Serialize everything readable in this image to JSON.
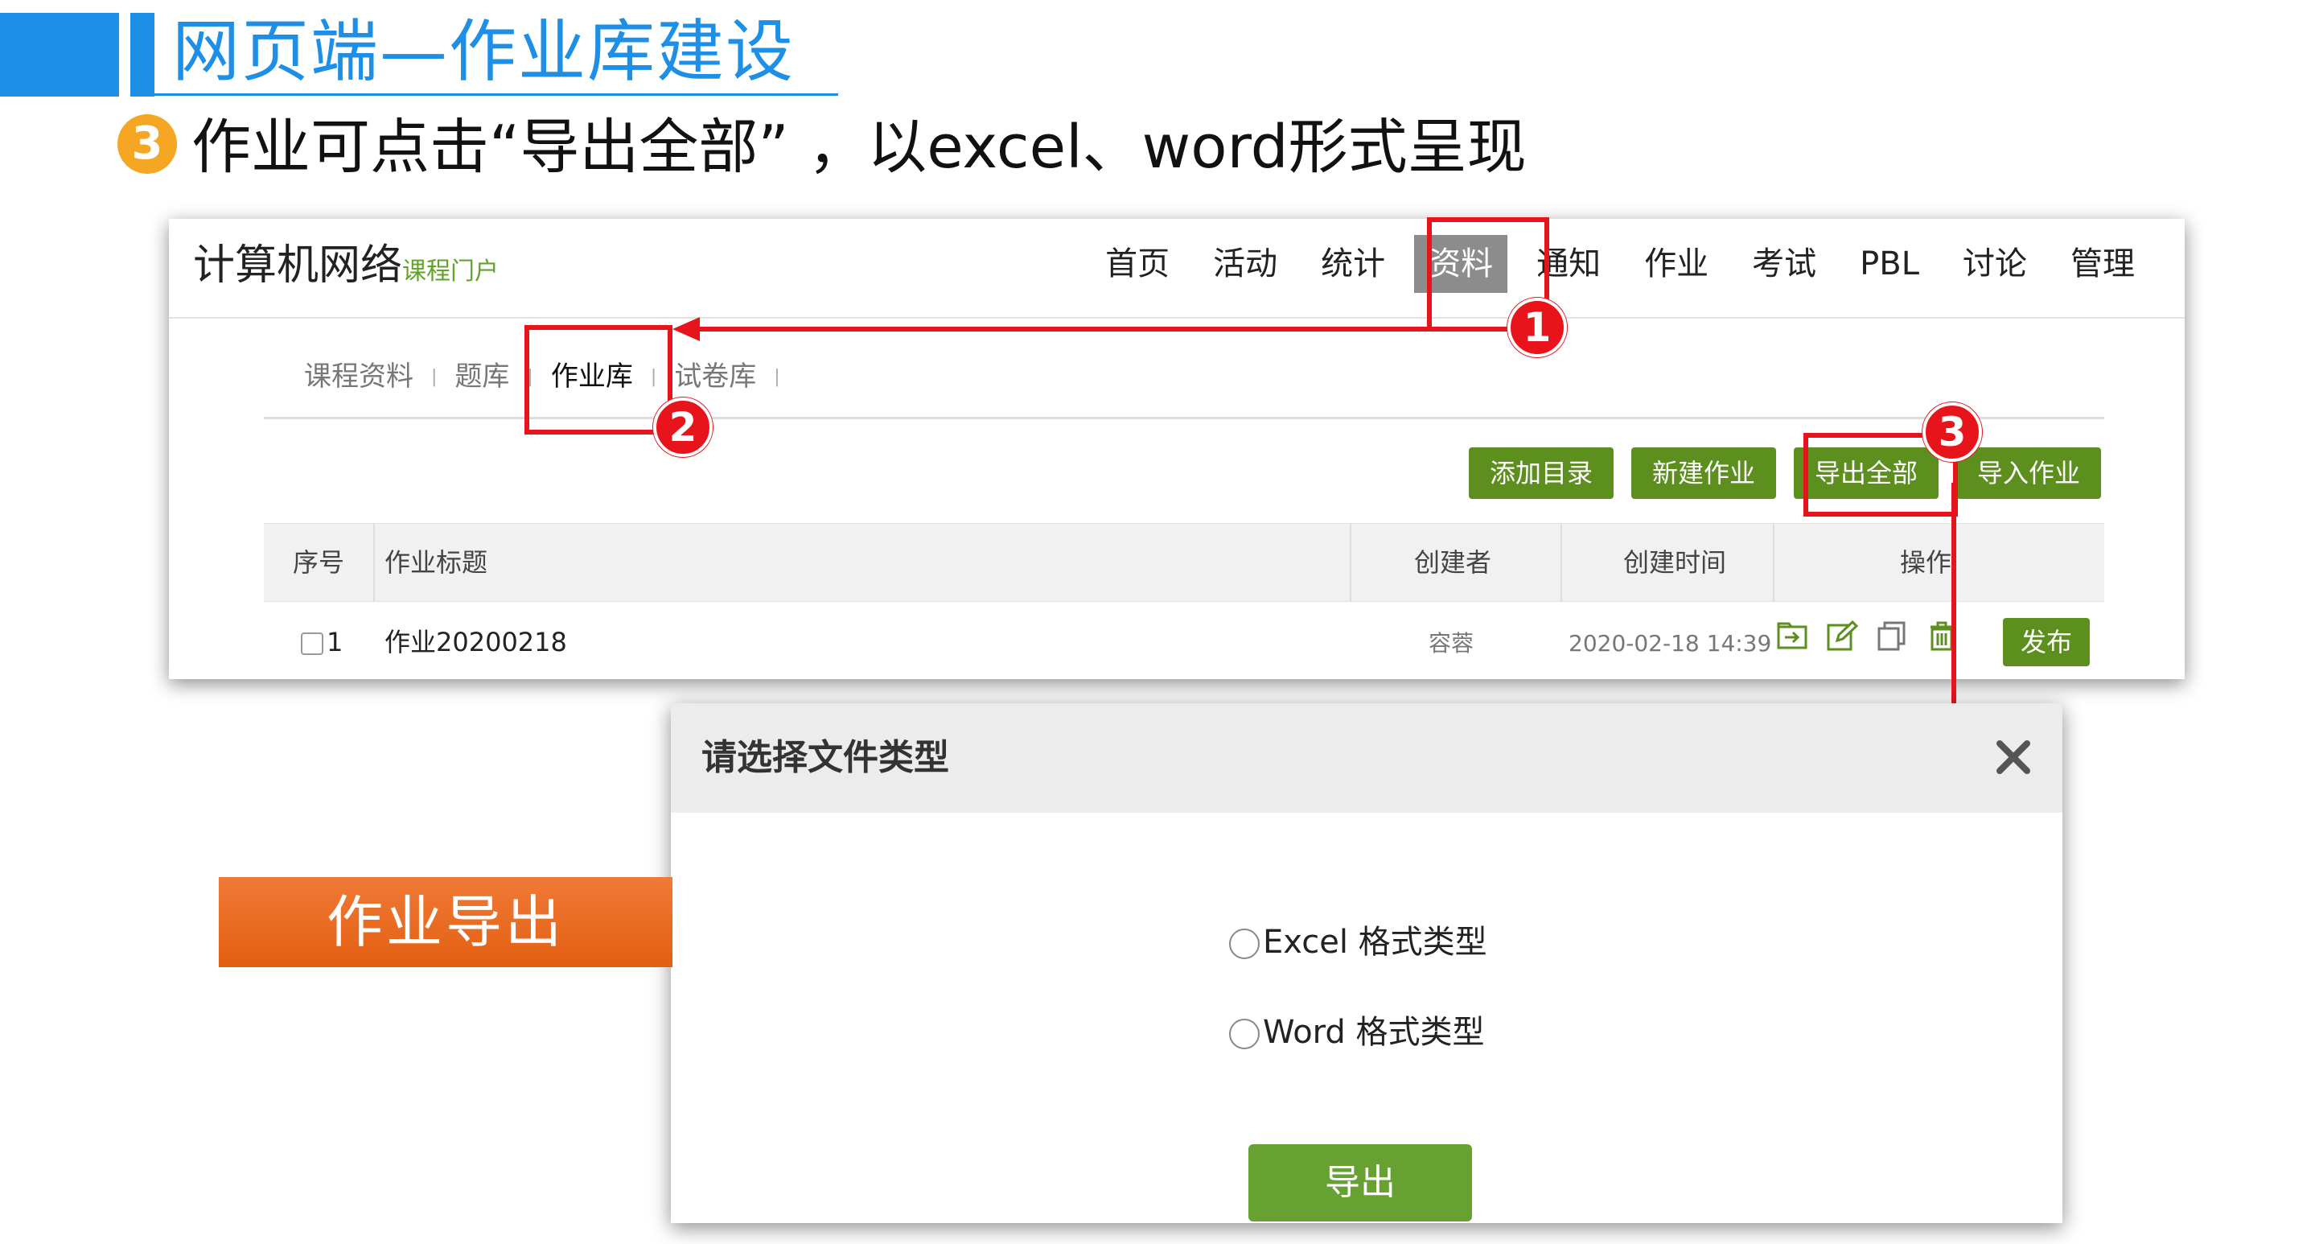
{
  "slide": {
    "title": "网页端—作业库建设",
    "step_number": "3",
    "step_text": "作业可点击“导出全部” ，以excel、word形式呈现"
  },
  "portal": {
    "course_name": "计算机网络",
    "course_sub": "课程门户",
    "nav": [
      "首页",
      "活动",
      "统计",
      "资料",
      "通知",
      "作业",
      "考试",
      "PBL",
      "讨论",
      "管理"
    ],
    "nav_active": "资料",
    "subtabs": [
      "课程资料",
      "题库",
      "作业库",
      "试卷库"
    ],
    "subtab_active": "作业库",
    "buttons": {
      "add_dir": "添加目录",
      "new_hw": "新建作业",
      "export_all": "导出全部",
      "import_hw": "导入作业"
    },
    "table": {
      "headers": {
        "index": "序号",
        "title": "作业标题",
        "creator": "创建者",
        "time": "创建时间",
        "ops": "操作"
      },
      "rows": [
        {
          "index": "1",
          "title": "作业20200218",
          "creator": "容蓉",
          "time": "2020-02-18 14:39",
          "publish": "发布"
        }
      ]
    }
  },
  "markers": [
    "1",
    "2",
    "3"
  ],
  "dialog": {
    "title": "请选择文件类型",
    "options": [
      "Excel 格式类型",
      "Word 格式类型"
    ],
    "export_button": "导出"
  },
  "side_label": "作业导出",
  "colors": {
    "accent_blue": "#1e8fe6",
    "green": "#5d8f1f",
    "red": "#e8141c",
    "orange": "#e9651c"
  }
}
